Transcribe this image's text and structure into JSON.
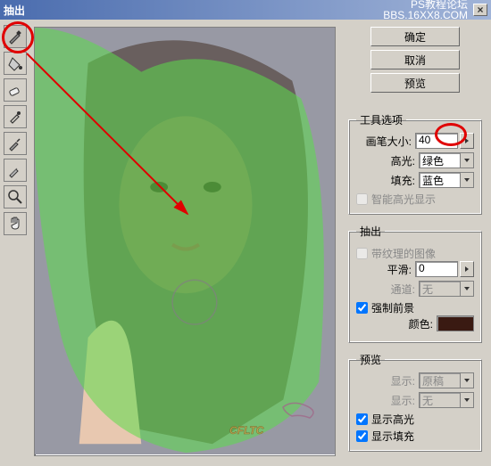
{
  "window": {
    "title": "抽出",
    "watermark_line1": "PS教程论坛",
    "watermark_line2": "BBS.16XX8.COM"
  },
  "buttons": {
    "ok": "确定",
    "cancel": "取消",
    "preview": "预览"
  },
  "tool_options": {
    "legend": "工具选项",
    "brush_size_label": "画笔大小:",
    "brush_size": "40",
    "highlight_label": "高光:",
    "highlight_value": "绿色",
    "fill_label": "填充:",
    "fill_value": "蓝色",
    "smart_highlight": "智能高光显示"
  },
  "extract": {
    "legend": "抽出",
    "textured": "带纹理的图像",
    "smooth_label": "平滑:",
    "smooth_value": "0",
    "channel_label": "通道:",
    "channel_value": "无",
    "force_fg": "强制前景",
    "color_label": "颜色:",
    "color_hex": "#3a1a12"
  },
  "preview_opts": {
    "legend": "预览",
    "show_label": "显示:",
    "show_value": "原稿",
    "display_label": "显示:",
    "display_value": "无",
    "show_highlight": "显示高光",
    "show_fill": "显示填充"
  },
  "watermark_text": "CFLTC"
}
